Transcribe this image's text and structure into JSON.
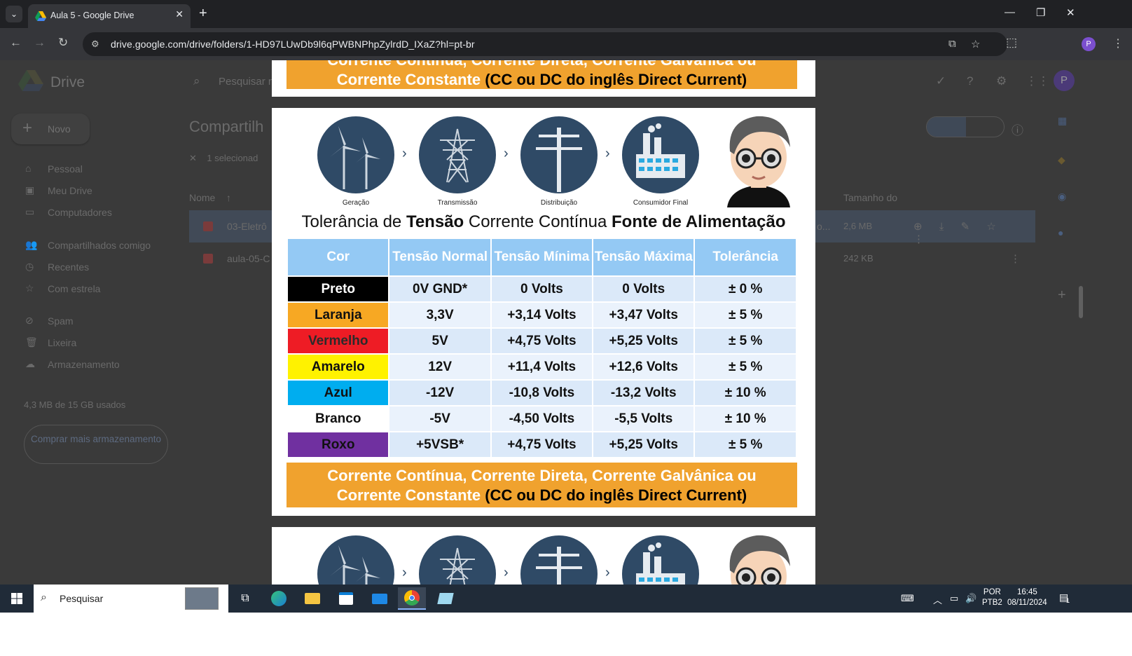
{
  "browser": {
    "tab_title": "Aula 5 - Google Drive",
    "tab_close": "✕",
    "new_tab": "+",
    "url": "drive.google.com/drive/folders/1-HD97LUwDb9l6qPWBNPhpZylrdD_IXaZ?hl=pt-br",
    "profile_initial": "P"
  },
  "drive": {
    "app_name": "Drive",
    "search_placeholder": "Pesquisar n",
    "new_button": "Novo",
    "sidebar": [
      {
        "label": "Pessoal",
        "icon": "home-icon"
      },
      {
        "label": "Meu Drive",
        "icon": "drive-icon"
      },
      {
        "label": "Computadores",
        "icon": "computer-icon"
      },
      {
        "label": "Compartilhados comigo",
        "icon": "people-icon"
      },
      {
        "label": "Recentes",
        "icon": "clock-icon"
      },
      {
        "label": "Com estrela",
        "icon": "star-icon"
      },
      {
        "label": "Spam",
        "icon": "spam-icon"
      },
      {
        "label": "Lixeira",
        "icon": "trash-icon"
      },
      {
        "label": "Armazenamento",
        "icon": "cloud-icon"
      }
    ],
    "storage_text": "4,3 MB de 15 GB usados",
    "buy_storage": "Comprar mais armazenamento",
    "page_title": "Compartilh",
    "selected_text": "1 selecionad",
    "column_name": "Nome",
    "column_size": "Tamanho do",
    "files": [
      {
        "name": "03-Eletrô",
        "size": "2,6 MB",
        "truncated_suffix": "o..."
      },
      {
        "name": "aula-05-C",
        "size": "242 KB"
      }
    ],
    "avatar_initial": "P"
  },
  "preview": {
    "top_banner_line1": "Corrente Contínua, Corrente Direta, Corrente Galvânica ou",
    "top_banner_line2_orange": "Corrente Constante",
    "top_banner_line2_dark": "(CC ou DC do inglês Direct Current)",
    "flow_labels": [
      "Geração",
      "Transmissão",
      "Distribuição",
      "Consumidor Final"
    ],
    "title_parts": [
      "Tolerância de ",
      "Tensão",
      " Corrente Contínua ",
      "Fonte de Alimentação"
    ],
    "headers": [
      "Cor",
      "Tensão Normal",
      "Tensão Mínima",
      "Tensão Máxima",
      "Tolerância"
    ],
    "rows": [
      {
        "cor": "Preto",
        "normal": "0V GND*",
        "min": "0 Volts",
        "max": "0 Volts",
        "tol": "± 0 %",
        "bg": "#000000",
        "fg": "#ffffff"
      },
      {
        "cor": "Laranja",
        "normal": "3,3V",
        "min": "+3,14 Volts",
        "max": "+3,47 Volts",
        "tol": "± 5 %",
        "bg": "#f7a823",
        "fg": "#111111"
      },
      {
        "cor": "Vermelho",
        "normal": "5V",
        "min": "+4,75 Volts",
        "max": "+5,25 Volts",
        "tol": "± 5 %",
        "bg": "#ee1c25",
        "fg": "#2b2b2b"
      },
      {
        "cor": "Amarelo",
        "normal": "12V",
        "min": "+11,4 Volts",
        "max": "+12,6 Volts",
        "tol": "± 5 %",
        "bg": "#fff200",
        "fg": "#111111"
      },
      {
        "cor": "Azul",
        "normal": "-12V",
        "min": "-10,8 Volts",
        "max": "-13,2 Volts",
        "tol": "± 10 %",
        "bg": "#00adef",
        "fg": "#111111"
      },
      {
        "cor": "Branco",
        "normal": "-5V",
        "min": "-4,50 Volts",
        "max": "-5,5 Volts",
        "tol": "± 10 %",
        "bg": "#ffffff",
        "fg": "#111111"
      },
      {
        "cor": "Roxo",
        "normal": "+5VSB*",
        "min": "+4,75 Volts",
        "max": "+5,25 Volts",
        "tol": "± 5 %",
        "bg": "#7030a0",
        "fg": "#111111"
      }
    ],
    "bottom_banner_line1": "Corrente Contínua, Corrente Direta, Corrente Galvânica ou",
    "bottom_banner_line2_orange": "Corrente Constante",
    "bottom_banner_line2_dark": "(CC ou DC do inglês Direct Current)"
  },
  "taskbar": {
    "search_placeholder": "Pesquisar",
    "lang_line1": "POR",
    "lang_line2": "PTB2",
    "time": "16:45",
    "date": "08/11/2024",
    "notification_count": "1"
  }
}
